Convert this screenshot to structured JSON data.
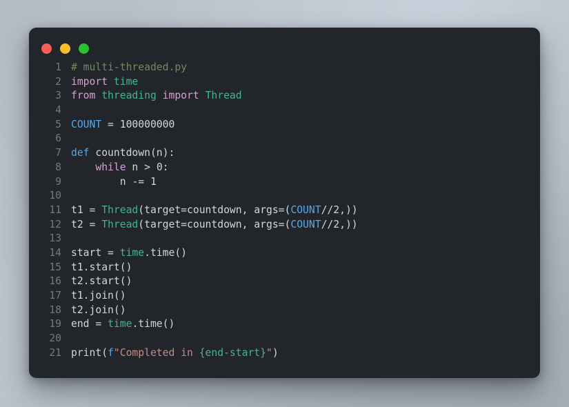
{
  "window": {
    "title": "multi-threaded.py",
    "controls": [
      {
        "name": "close",
        "color": "#f95f57"
      },
      {
        "name": "minimize",
        "color": "#fbbd2e"
      },
      {
        "name": "maximize",
        "color": "#2ac034"
      }
    ],
    "background_color": "#22252a",
    "desktop_background": "#b5bcc4"
  },
  "editor": {
    "language": "python",
    "gutter_color": "#737a82",
    "first_line_number": 1,
    "last_line_number": 21,
    "line_numbers": [
      "1",
      "2",
      "3",
      "4",
      "5",
      "6",
      "7",
      "8",
      "9",
      "10",
      "11",
      "12",
      "13",
      "14",
      "15",
      "16",
      "17",
      "18",
      "19",
      "20",
      "21"
    ],
    "lines": [
      "# multi-threaded.py",
      "import time",
      "from threading import Thread",
      "",
      "COUNT = 100000000",
      "",
      "def countdown(n):",
      "    while n > 0:",
      "        n -= 1",
      "",
      "t1 = Thread(target=countdown, args=(COUNT//2,))",
      "t2 = Thread(target=countdown, args=(COUNT//2,))",
      "",
      "start = time.time()",
      "t1.start()",
      "t2.start()",
      "t1.join()",
      "t2.join()",
      "end = time.time()",
      "",
      "print(f\"Completed in {end-start}\")"
    ],
    "tokens": {
      "l1": [
        [
          "# multi-threaded.py",
          "t-comment"
        ]
      ],
      "l2": [
        [
          "import",
          "t-kw"
        ],
        [
          " ",
          "t-plain"
        ],
        [
          "time",
          "t-mod"
        ]
      ],
      "l3": [
        [
          "from",
          "t-kw"
        ],
        [
          " ",
          "t-plain"
        ],
        [
          "threading",
          "t-mod"
        ],
        [
          " ",
          "t-plain"
        ],
        [
          "import",
          "t-kw"
        ],
        [
          " ",
          "t-plain"
        ],
        [
          "Thread",
          "t-class"
        ]
      ],
      "l4": [],
      "l5": [
        [
          "COUNT",
          "t-const"
        ],
        [
          " = ",
          "t-op"
        ],
        [
          "100000000",
          "t-num"
        ]
      ],
      "l6": [],
      "l7": [
        [
          "def",
          "t-def"
        ],
        [
          " ",
          "t-plain"
        ],
        [
          "countdown",
          "t-func"
        ],
        [
          "(n):",
          "t-plain"
        ]
      ],
      "l8": [
        [
          "    ",
          "t-plain"
        ],
        [
          "while",
          "t-kw"
        ],
        [
          " n > ",
          "t-plain"
        ],
        [
          "0",
          "t-num"
        ],
        [
          ":",
          "t-plain"
        ]
      ],
      "l9": [
        [
          "        n -= ",
          "t-plain"
        ],
        [
          "1",
          "t-num"
        ]
      ],
      "l10": [],
      "l11": [
        [
          "t1 = ",
          "t-plain"
        ],
        [
          "Thread",
          "t-class"
        ],
        [
          "(target=countdown, args=(",
          "t-plain"
        ],
        [
          "COUNT",
          "t-const"
        ],
        [
          "//",
          "t-plain"
        ],
        [
          "2",
          "t-num"
        ],
        [
          ",))",
          "t-plain"
        ]
      ],
      "l12": [
        [
          "t2 = ",
          "t-plain"
        ],
        [
          "Thread",
          "t-class"
        ],
        [
          "(target=countdown, args=(",
          "t-plain"
        ],
        [
          "COUNT",
          "t-const"
        ],
        [
          "//",
          "t-plain"
        ],
        [
          "2",
          "t-num"
        ],
        [
          ",))",
          "t-plain"
        ]
      ],
      "l13": [],
      "l14": [
        [
          "start = ",
          "t-plain"
        ],
        [
          "time",
          "t-mod"
        ],
        [
          ".time()",
          "t-plain"
        ]
      ],
      "l15": [
        [
          "t1.start()",
          "t-plain"
        ]
      ],
      "l16": [
        [
          "t2.start()",
          "t-plain"
        ]
      ],
      "l17": [
        [
          "t1.join()",
          "t-plain"
        ]
      ],
      "l18": [
        [
          "t2.join()",
          "t-plain"
        ]
      ],
      "l19": [
        [
          "end = ",
          "t-plain"
        ],
        [
          "time",
          "t-mod"
        ],
        [
          ".time()",
          "t-plain"
        ]
      ],
      "l20": [],
      "l21": [
        [
          "print",
          "t-plain"
        ],
        [
          "(",
          "t-plain"
        ],
        [
          "f",
          "t-fprefix"
        ],
        [
          "\"Completed in ",
          "t-str"
        ],
        [
          "{end-start}",
          "t-interp"
        ],
        [
          "\"",
          "t-str"
        ],
        [
          ")",
          "t-plain"
        ]
      ]
    }
  }
}
